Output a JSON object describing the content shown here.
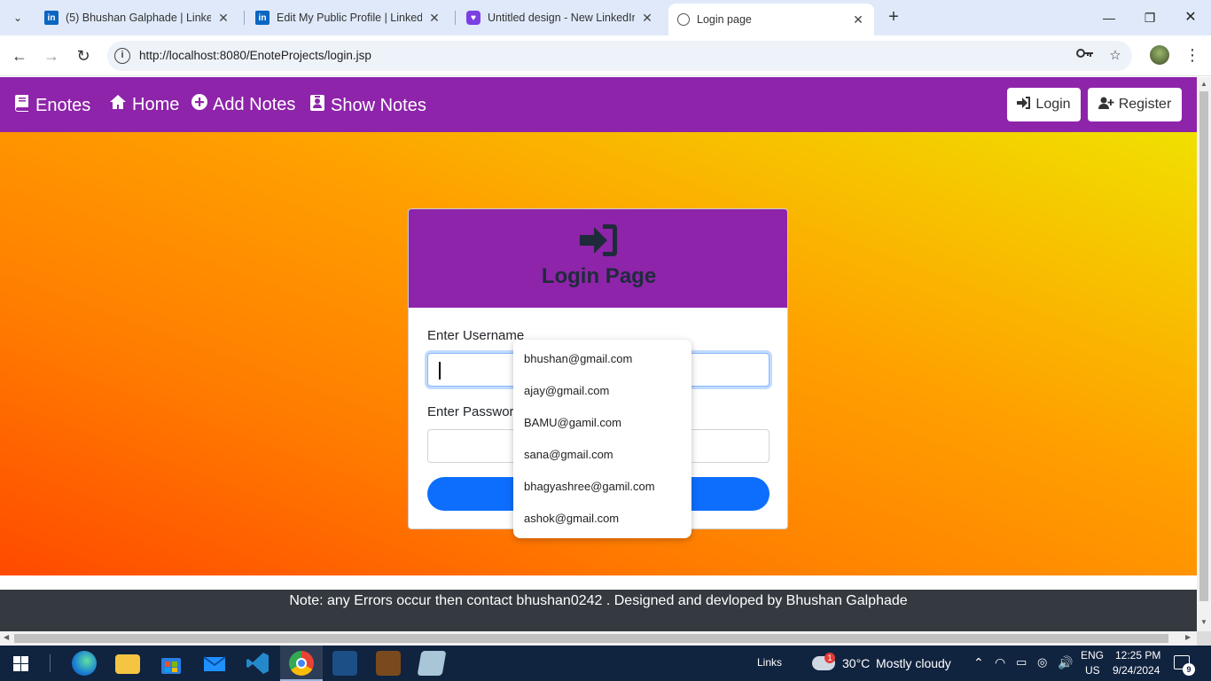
{
  "browser": {
    "tabs": [
      {
        "title": "(5) Bhushan Galphade | LinkedIn",
        "favicon": "linkedin-icon",
        "active": false
      },
      {
        "title": "Edit My Public Profile | LinkedIn",
        "favicon": "linkedin-icon",
        "active": false
      },
      {
        "title": "Untitled design - New LinkedIn",
        "favicon": "canva-icon",
        "active": false
      },
      {
        "title": "Login page",
        "favicon": "globe-icon",
        "active": true
      }
    ],
    "url": "http://localhost:8080/EnoteProjects/login.jsp"
  },
  "navbar": {
    "brand": "Enotes",
    "links": [
      "Home",
      "Add Notes",
      "Show Notes"
    ],
    "login_label": "Login",
    "register_label": "Register",
    "color": "#8e24aa"
  },
  "login": {
    "heading": "Login Page",
    "username_label": "Enter Username",
    "password_label": "Enter Password",
    "username_value": "",
    "password_value": "",
    "submit_label": "Login"
  },
  "autofill": {
    "suggestions": [
      "bhushan@gmail.com",
      "ajay@gmail.com",
      "BAMU@gamil.com",
      "sana@gmail.com",
      "bhagyashree@gamil.com",
      "ashok@gmail.com"
    ]
  },
  "footer": {
    "text": "Note: any Errors occur then contact bhushan0242 . Designed and devloped by Bhushan Galphade"
  },
  "taskbar": {
    "links_label": "Links",
    "weather_temp": "30°C",
    "weather_desc": "Mostly cloudy",
    "weather_badge": "1",
    "lang_top": "ENG",
    "lang_bottom": "US",
    "time": "12:25 PM",
    "date": "9/24/2024",
    "notification_count": "9"
  }
}
